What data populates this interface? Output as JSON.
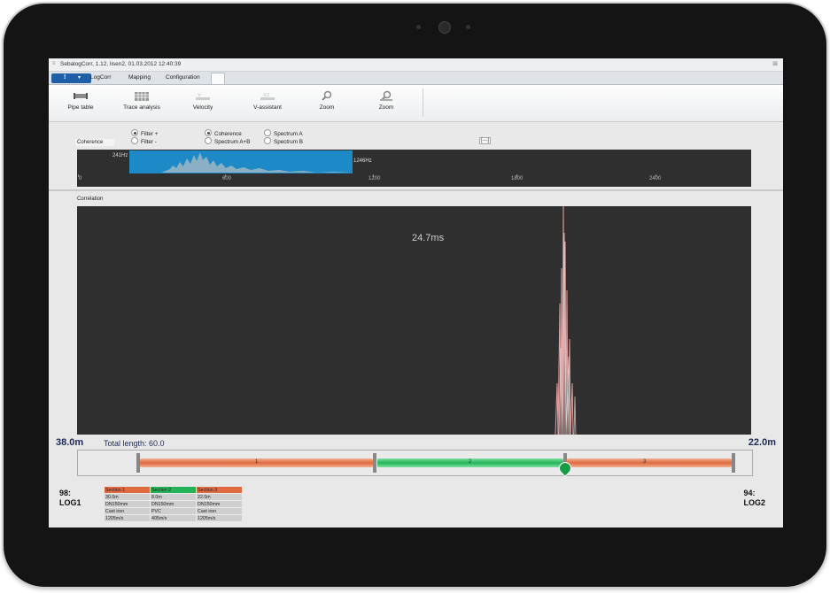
{
  "window": {
    "title": "SebalogCorr, 1.12, lisen2, 01.03.2012 12:40:39"
  },
  "tabs": [
    {
      "label": "LogCorr"
    },
    {
      "label": "Mapping"
    },
    {
      "label": "Configuration"
    }
  ],
  "ribbon": {
    "buttons": [
      {
        "label": "Pipe table",
        "icon": "pipe-table-icon"
      },
      {
        "label": "Trace analysis",
        "icon": "trace-analysis-icon"
      },
      {
        "label": "Velocity",
        "icon": "velocity-icon"
      },
      {
        "label": "V-assistant",
        "icon": "v-assistant-icon"
      },
      {
        "label": "Zoom",
        "icon": "zoom-in-icon"
      },
      {
        "label": "Zoom",
        "icon": "zoom-out-icon"
      }
    ]
  },
  "coherence": {
    "title": "Coherence",
    "filters": [
      {
        "label": "Filter +",
        "selected": true
      },
      {
        "label": "Filter -",
        "selected": false
      }
    ],
    "modes": [
      {
        "label": "Coherence",
        "selected": true
      },
      {
        "label": "Spectrum A+B",
        "selected": false
      },
      {
        "label": "Spectrum A",
        "selected": false
      },
      {
        "label": "Spectrum B",
        "selected": false
      }
    ],
    "expand_label": "[---]",
    "band_low": "241Hz",
    "band_high": "1246Hz",
    "ticks": [
      "0",
      "600",
      "1200",
      "1800",
      "2400"
    ],
    "band_color": "#1d8ac7"
  },
  "correlation": {
    "title": "Correlation",
    "value": "24.7ms"
  },
  "pipe": {
    "left_distance": "38.0m",
    "right_distance": "22.0m",
    "total_length": "Total length: 60.0",
    "sections": [
      "1",
      "2",
      "3"
    ],
    "left_logger": {
      "id": "98:",
      "name": "LOG1"
    },
    "right_logger": {
      "id": "94:",
      "name": "LOG2"
    },
    "colors": {
      "orange": "#e06a40",
      "green": "#22b358"
    }
  },
  "section_table": {
    "headers": [
      "Section 1",
      "Section 2",
      "Section 3"
    ],
    "rows": [
      [
        "30.0m",
        "8.0m",
        "22.0m"
      ],
      [
        "DN150mm",
        "DN150mm",
        "DN150mm"
      ],
      [
        "Cast iron",
        "PVC",
        "Cast iron"
      ],
      [
        "1205m/s",
        "405m/s",
        "1205m/s"
      ]
    ]
  }
}
